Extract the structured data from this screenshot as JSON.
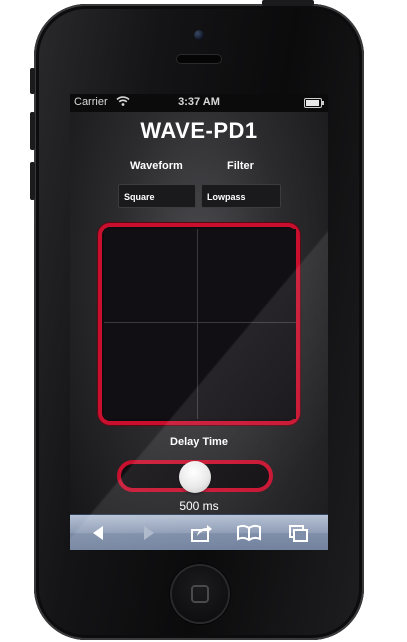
{
  "status_bar": {
    "carrier": "Carrier",
    "time": "3:37 AM",
    "battery_level": 0.9
  },
  "app": {
    "title": "WAVE-PD1",
    "waveform": {
      "label": "Waveform",
      "selected": "Square"
    },
    "filter": {
      "label": "Filter",
      "selected": "Lowpass"
    },
    "xy_pad": {
      "quadrants": 4
    },
    "delay": {
      "label": "Delay Time",
      "value_text": "500 ms",
      "slider_fraction": 0.5
    }
  },
  "toolbar": {
    "icons": [
      "back-icon",
      "forward-icon",
      "share-icon",
      "bookmarks-icon",
      "tabs-icon"
    ]
  },
  "colors": {
    "accent": "#c8102e",
    "pad_background": "#0f0c10",
    "toolbar": "#8c9ab3"
  }
}
